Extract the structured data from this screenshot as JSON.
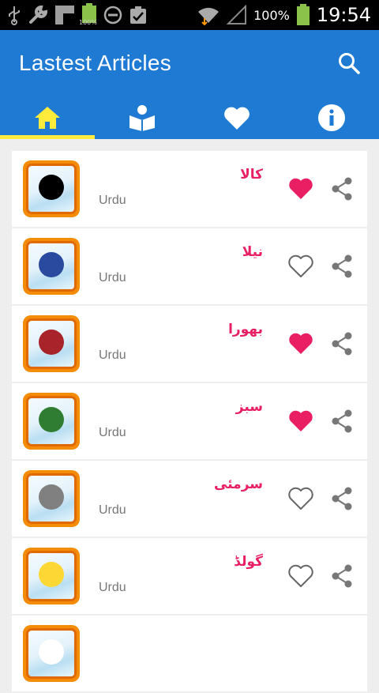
{
  "status_bar": {
    "battery_small_label": "100%",
    "battery_pct": "100%",
    "time": "19:54"
  },
  "app_bar": {
    "title": "Lastest Articles",
    "search_icon": "search-icon"
  },
  "tabs": [
    {
      "icon": "home-icon",
      "active": true
    },
    {
      "icon": "book-reader-icon",
      "active": false
    },
    {
      "icon": "heart-icon",
      "active": false
    },
    {
      "icon": "info-icon",
      "active": false
    }
  ],
  "colors": {
    "primary": "#1f7ad4",
    "tab_indicator": "#ffeb3b",
    "accent_pink": "#e91e63"
  },
  "articles": [
    {
      "name": "کالا",
      "language": "Urdu",
      "color": "#000000",
      "favorite": true
    },
    {
      "name": "نیلا",
      "language": "Urdu",
      "color": "#2a4aa0",
      "favorite": false
    },
    {
      "name": "بھورا",
      "language": "Urdu",
      "color": "#a8242a",
      "favorite": true
    },
    {
      "name": "سبز",
      "language": "Urdu",
      "color": "#2e7d32",
      "favorite": true
    },
    {
      "name": "سرمئی",
      "language": "Urdu",
      "color": "#808080",
      "favorite": false
    },
    {
      "name": "گولڈ",
      "language": "Urdu",
      "color": "#fdd835",
      "favorite": false
    },
    {
      "name": "",
      "language": "",
      "color": "#ffffff",
      "favorite": false
    }
  ]
}
